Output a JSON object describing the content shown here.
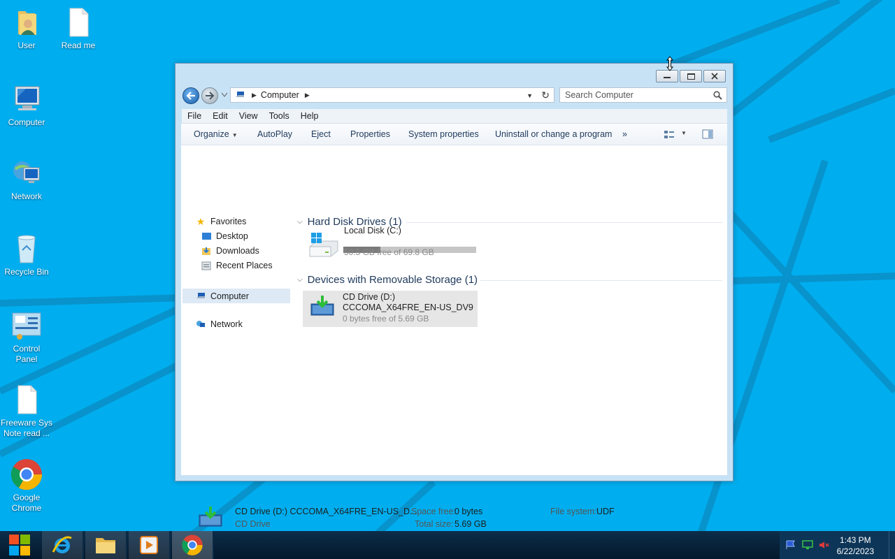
{
  "desktop": {
    "icons": [
      {
        "label": "User"
      },
      {
        "label": "Read me"
      },
      {
        "label": "Computer"
      },
      {
        "label": "Network"
      },
      {
        "label": "Recycle Bin"
      },
      {
        "label": "Control\nPanel"
      },
      {
        "label": "Freeware Sys\nNote read ..."
      },
      {
        "label": "Google\nChrome"
      }
    ]
  },
  "window": {
    "address": {
      "location": "Computer"
    },
    "search": {
      "placeholder": "Search Computer"
    },
    "menu": [
      "File",
      "Edit",
      "View",
      "Tools",
      "Help"
    ],
    "toolbar": {
      "organize": "Organize",
      "autoplay": "AutoPlay",
      "eject": "Eject",
      "properties": "Properties",
      "system_properties": "System properties",
      "uninstall": "Uninstall or change a program",
      "more": "»"
    },
    "nav_pane": {
      "favorites": "Favorites",
      "desktop": "Desktop",
      "downloads": "Downloads",
      "recent_places": "Recent Places",
      "computer": "Computer",
      "network": "Network"
    },
    "groups": {
      "hard_disk": {
        "title": "Hard Disk Drives (1)",
        "drives": [
          {
            "name": "Local Disk (C:)",
            "free_text": "50.5 GB free of 69.8 GB",
            "used_fraction": 0.28
          }
        ]
      },
      "removable": {
        "title": "Devices with Removable Storage (1)",
        "drives": [
          {
            "name": "CD Drive (D:)",
            "label": "CCCOMA_X64FRE_EN-US_DV9",
            "free_text": "0 bytes free of 5.69 GB"
          }
        ]
      }
    },
    "details": {
      "title": "CD Drive (D:) CCCOMA_X64FRE_EN-US_D...",
      "type": "CD Drive",
      "space_free_label": "Space free:",
      "space_free_value": "0 bytes",
      "total_size_label": "Total size:",
      "total_size_value": "5.69 GB",
      "file_system_label": "File system:",
      "file_system_value": "UDF"
    }
  },
  "taskbar": {
    "clock_time": "1:43 PM",
    "clock_date": "6/22/2023"
  },
  "colors": {
    "desktop_bg": "#00aeef",
    "window_frame": "#c7e2f5",
    "taskbar": "#0c2d4a"
  }
}
